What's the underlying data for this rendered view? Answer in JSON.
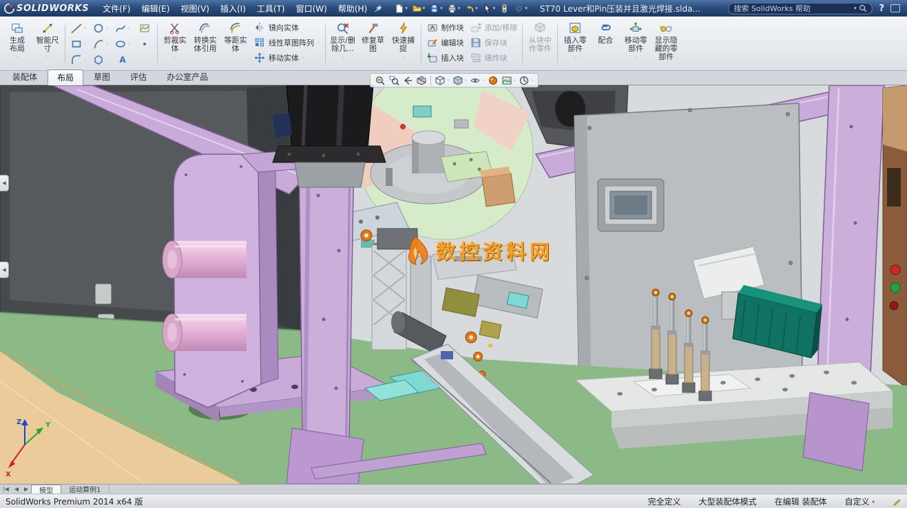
{
  "app": {
    "name": "SolidWorks"
  },
  "colors": {
    "titlebar_navy": "#2b4d7c",
    "frame_lavender": "#c9abd9",
    "floor_green": "#8cba86",
    "floor_wood": "#eccb9a",
    "motor_teal": "#0f7262",
    "watermark_orange": "#f7a11e"
  },
  "title_bar": {
    "logo_text": "SOLIDWORKS",
    "menus": [
      "文件(F)",
      "编辑(E)",
      "视图(V)",
      "插入(I)",
      "工具(T)",
      "窗口(W)",
      "帮助(H)"
    ],
    "document_title": "ST70 Lever和Pin压装并且激光焊接.slda...",
    "search_placeholder": "搜索 SolidWorks 帮助",
    "help_label": "?"
  },
  "quick_access_icons": [
    "new-document",
    "open",
    "save",
    "print",
    "undo",
    "select",
    "rebuild",
    "options"
  ],
  "ribbon": {
    "buttons": {
      "generate_layout": "生成\n布局",
      "smart_dimension": "智能尺\n寸",
      "trim_entities": "剪裁实\n体",
      "convert_entities": "转换实\n体引用",
      "offset_entities": "等距实\n体",
      "mirror_entities": "镜向实体",
      "linear_sketch_pattern": "线性草图阵列",
      "move_entities": "移动实体",
      "display_delete": "显示/删\n除几...",
      "repair_sketch": "修复草\n图",
      "quick_snaps": "快速捕\n捉",
      "make_block": "制作块",
      "edit_block": "编辑块",
      "insert_block": "插入块",
      "add_remove": "添加/移除",
      "save_block": "保存块",
      "explode_block": "爆炸块",
      "make_part_from_block": "从块中\n作零件",
      "insert_components": "插入零\n部件",
      "mate": "配合",
      "move_component": "移动零\n部件",
      "show_hidden": "显示隐\n藏的零\n部件"
    },
    "sketch_tool_icons": [
      "line",
      "circle",
      "spline",
      "sketch-picture",
      "rectangle",
      "arc",
      "ellipse",
      "point",
      "fillet",
      "polygon",
      "text"
    ]
  },
  "command_tabs": {
    "items": [
      "装配体",
      "布局",
      "草图",
      "评估",
      "办公室产品"
    ],
    "active": "布局"
  },
  "viewport": {
    "watermark_text": "数控资料网",
    "triad": {
      "x": "X",
      "y": "Y",
      "z": "Z"
    },
    "headsup_icons": [
      "zoom-fit",
      "zoom-area",
      "previous-view",
      "section-view",
      "view-orientation",
      "display-style",
      "hide-show-items",
      "edit-appearance",
      "apply-scene",
      "view-settings"
    ]
  },
  "bottom_tabs": {
    "items": [
      "模型",
      "运动算例1"
    ],
    "active": "模型"
  },
  "status_bar": {
    "left_text": "SolidWorks Premium 2014 x64 版",
    "items": [
      "完全定义",
      "大型装配体模式",
      "在编辑 装配体"
    ],
    "customize_label": "自定义"
  }
}
